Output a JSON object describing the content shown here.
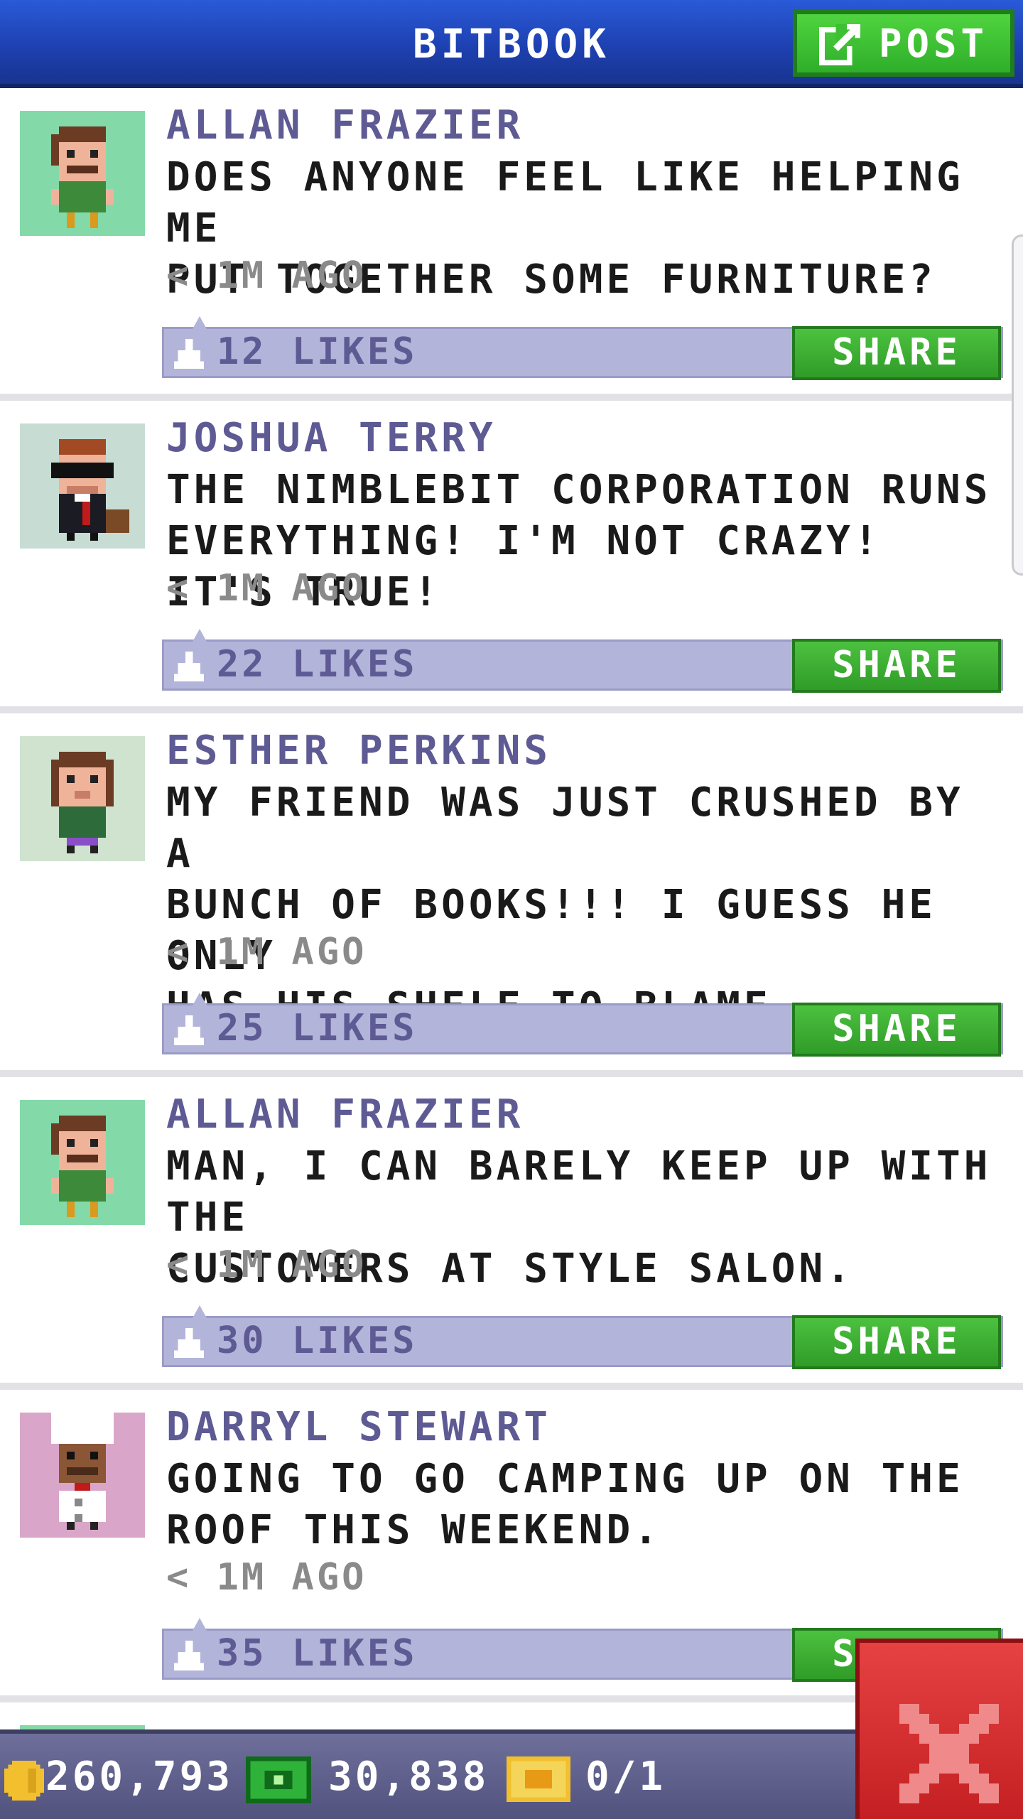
{
  "app": {
    "title": "BITBOOK",
    "post_label": "POST"
  },
  "colors": {
    "accent": "#2a5ad8",
    "share": "#3fae2f",
    "likes_bar": "#b3b4d9",
    "author": "#5e5a94"
  },
  "posts": [
    {
      "author": "ALLAN FRAZIER",
      "message": "DOES ANYONE FEEL LIKE HELPING ME\nPUT TOGETHER SOME FURNITURE?",
      "time": "< 1M AGO",
      "likes": "12 LIKES",
      "share": "SHARE",
      "avatar": "allan-avatar"
    },
    {
      "author": "JOSHUA TERRY",
      "message": "THE NIMBLEBIT CORPORATION RUNS\nEVERYTHING! I'M NOT CRAZY! IT'S TRUE!",
      "time": "< 1M AGO",
      "likes": "22 LIKES",
      "share": "SHARE",
      "avatar": "joshua-avatar"
    },
    {
      "author": "ESTHER PERKINS",
      "message": "MY FRIEND WAS JUST CRUSHED BY A\nBUNCH OF BOOKS!!! I GUESS HE ONLY\nHAS HIS SHELF TO BLAME.",
      "time": "< 1M AGO",
      "likes": "25 LIKES",
      "share": "SHARE",
      "avatar": "esther-avatar"
    },
    {
      "author": "ALLAN FRAZIER",
      "message": "MAN, I CAN BARELY KEEP UP WITH THE\nCUSTOMERS AT STYLE SALON.",
      "time": "< 1M AGO",
      "likes": "30 LIKES",
      "share": "SHARE",
      "avatar": "allan-avatar"
    },
    {
      "author": "DARRYL STEWART",
      "message": "GOING TO GO CAMPING UP ON THE\nROOF THIS WEEKEND.",
      "time": "< 1M AGO",
      "likes": "35 LIKES",
      "share": "SHARE",
      "avatar": "darryl-avatar"
    }
  ],
  "footer": {
    "coins": "260,793",
    "bux": "30,838",
    "tickets": "0/1"
  },
  "icons": {
    "post": "compose-icon",
    "close": "close-icon",
    "coin": "coin-icon",
    "bux": "cash-icon",
    "ticket": "ticket-icon",
    "like": "thumb-icon"
  }
}
